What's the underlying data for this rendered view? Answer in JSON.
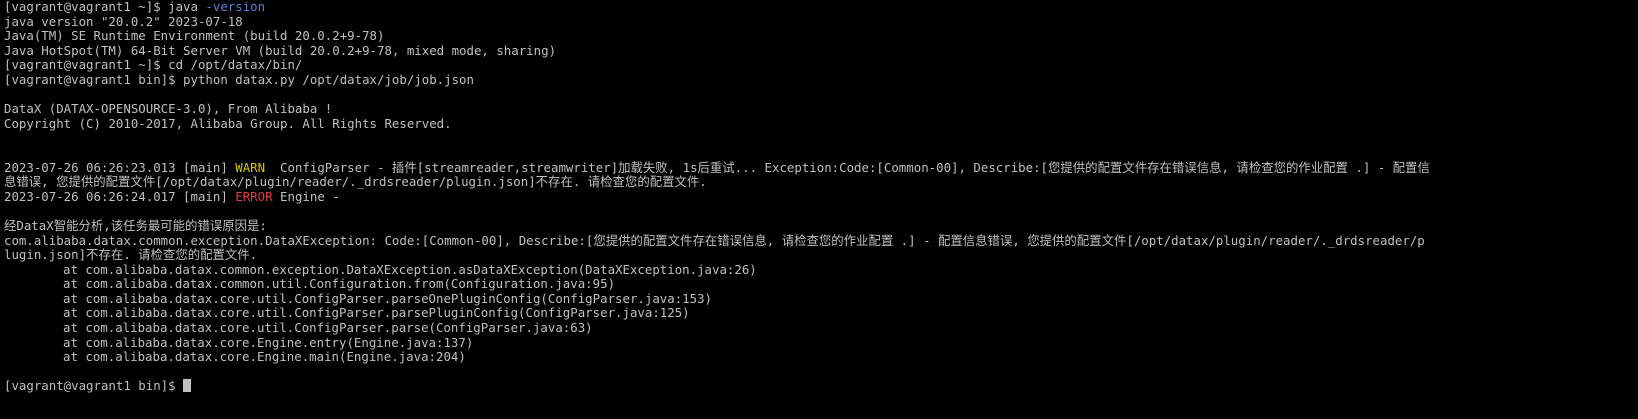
{
  "terminal": {
    "l01_prompt": "[vagrant@vagrant1 ~]$ java ",
    "l01_arg": "-version",
    "l02": "java version \"20.0.2\" 2023-07-18",
    "l03": "Java(TM) SE Runtime Environment (build 20.0.2+9-78)",
    "l04": "Java HotSpot(TM) 64-Bit Server VM (build 20.0.2+9-78, mixed mode, sharing)",
    "l05": "[vagrant@vagrant1 ~]$ cd /opt/datax/bin/",
    "l06": "[vagrant@vagrant1 bin]$ python datax.py /opt/datax/job/job.json",
    "l08": "DataX (DATAX-OPENSOURCE-3.0), From Alibaba !",
    "l09": "Copyright (C) 2010-2017, Alibaba Group. All Rights Reserved.",
    "l12_pre": "2023-07-26 06:26:23.013 [main] ",
    "l12_level": "WARN",
    "l12_post": "  ConfigParser - 插件[streamreader,streamwriter]加载失败, 1s后重试... Exception:Code:[Common-00], Describe:[您提供的配置文件存在错误信息, 请检查您的作业配置 .] - 配置信",
    "l13": "息错误, 您提供的配置文件[/opt/datax/plugin/reader/._drdsreader/plugin.json]不存在. 请检查您的配置文件.",
    "l14_pre": "2023-07-26 06:26:24.017 [main] ",
    "l14_level": "ERROR",
    "l14_post": " Engine -",
    "l16": "经DataX智能分析,该任务最可能的错误原因是:",
    "l17": "com.alibaba.datax.common.exception.DataXException: Code:[Common-00], Describe:[您提供的配置文件存在错误信息, 请检查您的作业配置 .] - 配置信息错误, 您提供的配置文件[/opt/datax/plugin/reader/._drdsreader/p",
    "l18": "lugin.json]不存在. 请检查您的配置文件.",
    "stack": [
      "at com.alibaba.datax.common.exception.DataXException.asDataXException(DataXException.java:26)",
      "at com.alibaba.datax.common.util.Configuration.from(Configuration.java:95)",
      "at com.alibaba.datax.core.util.ConfigParser.parseOnePluginConfig(ConfigParser.java:153)",
      "at com.alibaba.datax.core.util.ConfigParser.parsePluginConfig(ConfigParser.java:125)",
      "at com.alibaba.datax.core.util.ConfigParser.parse(ConfigParser.java:63)",
      "at com.alibaba.datax.core.Engine.entry(Engine.java:137)",
      "at com.alibaba.datax.core.Engine.main(Engine.java:204)"
    ],
    "final_prompt": "[vagrant@vagrant1 bin]$ "
  },
  "colors": {
    "background": "#000000",
    "text": "#c0c0c0",
    "arg_blue": "#5b7fd8",
    "warn_yellow": "#d8c41a",
    "error_red": "#e23a3a"
  }
}
